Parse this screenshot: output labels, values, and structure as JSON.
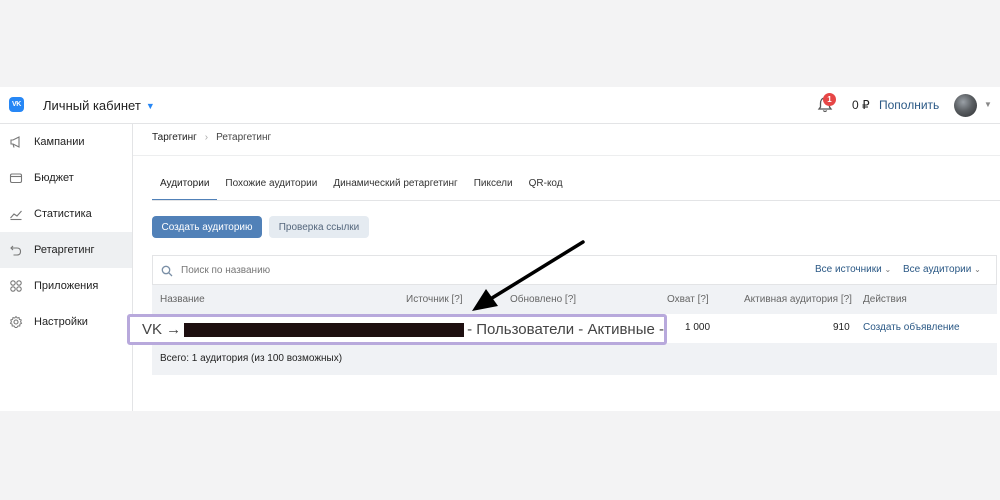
{
  "header": {
    "cabinet_label": "Личный кабинет",
    "notification_count": "1",
    "balance": "0 ₽",
    "topup_label": "Пополнить"
  },
  "sidebar": {
    "items": [
      {
        "label": "Кампании",
        "icon": "megaphone-icon"
      },
      {
        "label": "Бюджет",
        "icon": "wallet-icon"
      },
      {
        "label": "Статистика",
        "icon": "chart-icon"
      },
      {
        "label": "Ретаргетинг",
        "icon": "retarget-icon",
        "active": true
      },
      {
        "label": "Приложения",
        "icon": "apps-icon"
      },
      {
        "label": "Настройки",
        "icon": "gear-icon"
      }
    ]
  },
  "breadcrumb": {
    "parent": "Таргетинг",
    "current": "Ретаргетинг"
  },
  "tabs": [
    {
      "label": "Аудитории",
      "active": true
    },
    {
      "label": "Похожие аудитории"
    },
    {
      "label": "Динамический ретаргетинг"
    },
    {
      "label": "Пиксели"
    },
    {
      "label": "QR-код"
    }
  ],
  "actions": {
    "create_label": "Создать аудиторию",
    "check_label": "Проверка ссылки"
  },
  "search": {
    "placeholder": "Поиск по названию",
    "filter_sources": "Все источники",
    "filter_audiences": "Все аудитории"
  },
  "table": {
    "columns": {
      "name": "Название",
      "source": "Источник [?]",
      "updated": "Обновлено [?]",
      "reach": "Охват [?]",
      "active_audience": "Активная аудитория [?]",
      "actions": "Действия"
    },
    "rows": [
      {
        "name_prefix": "VK →",
        "name_suffix": "- Пользователи - Активные -",
        "reach": "1 000",
        "active_audience": "910",
        "action": "Создать объявление"
      }
    ],
    "footer": "Всего: 1 аудитория (из 100 возможных)"
  },
  "colors": {
    "accent": "#5181b8",
    "link": "#2a5885",
    "highlight_border": "#b8a9dc",
    "badge": "#e64646"
  }
}
